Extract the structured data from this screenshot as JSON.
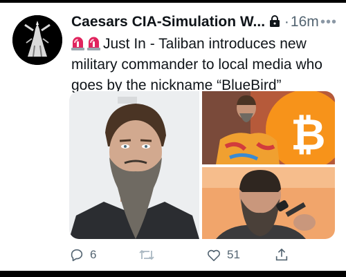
{
  "tweet": {
    "author_name": "Caesars CIA-Simulation W...",
    "separator": "·",
    "time": "16m",
    "text": "Just In - Taliban introduces new military commander to local media who goes by the nickname “BlueBird”",
    "media": [
      {
        "description": "man-with-beard-portrait"
      },
      {
        "description": "man-in-tie-dye-shirt-bitcoin"
      },
      {
        "description": "man-with-beard-microphone"
      }
    ]
  },
  "actions": {
    "reply_count": "6",
    "retweet_count": "",
    "like_count": "51"
  },
  "colors": {
    "text": "#0f1419",
    "secondary": "#536471",
    "bitcoin": "#f7931a",
    "siren": "#e0245e"
  }
}
